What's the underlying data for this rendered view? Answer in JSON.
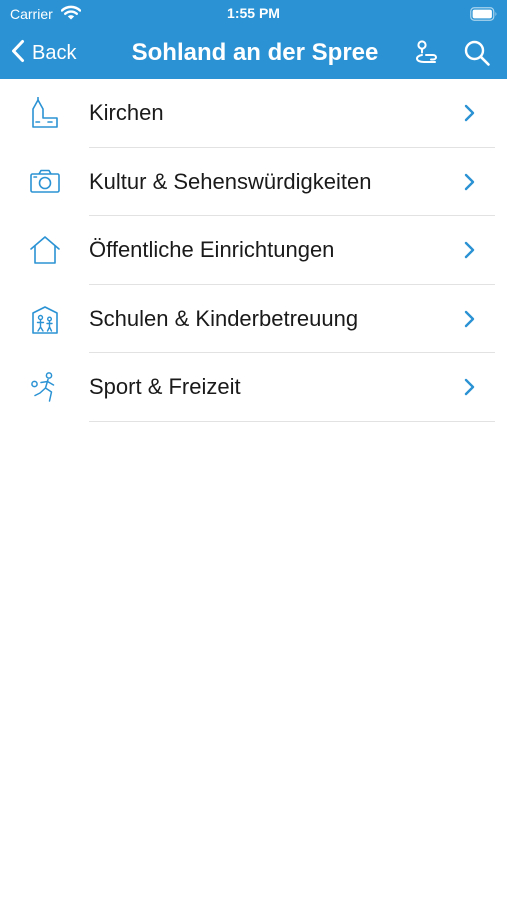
{
  "status_bar": {
    "carrier": "Carrier",
    "time": "1:55 PM"
  },
  "nav": {
    "back_label": "Back",
    "title": "Sohland an der Spree",
    "icons": [
      "route-icon",
      "search-icon"
    ]
  },
  "colors": {
    "nav_background": "#2b93d4",
    "accent": "#2b93d4",
    "separator": "#e2e2e2"
  },
  "categories": [
    {
      "label": "Kirchen",
      "icon": "church-icon"
    },
    {
      "label": "Kultur & Sehenswürdigkeiten",
      "icon": "camera-icon"
    },
    {
      "label": "Öffentliche Einrichtungen",
      "icon": "house-icon"
    },
    {
      "label": "Schulen & Kinderbetreuung",
      "icon": "school-icon"
    },
    {
      "label": "Sport & Freizeit",
      "icon": "sport-icon"
    }
  ]
}
